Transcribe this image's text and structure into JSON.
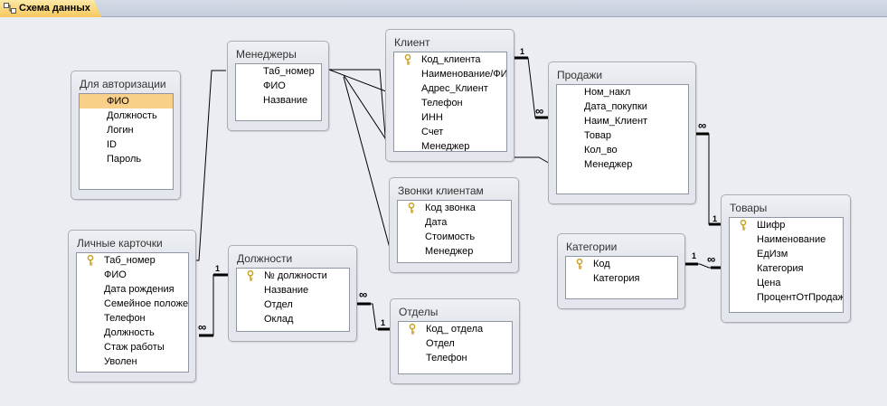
{
  "tab": {
    "label": "Схема данных",
    "icon": "relationships-icon"
  },
  "tables": {
    "auth": {
      "title": "Для авторизации",
      "fields": [
        {
          "name": "ФИО",
          "key": false,
          "selected": true
        },
        {
          "name": "Должность",
          "key": false
        },
        {
          "name": "Логин",
          "key": false
        },
        {
          "name": "ID",
          "key": false
        },
        {
          "name": "Пароль",
          "key": false
        }
      ]
    },
    "cards": {
      "title": "Личные карточки",
      "fields": [
        {
          "name": "Таб_номер",
          "key": true
        },
        {
          "name": "ФИО",
          "key": false
        },
        {
          "name": "Дата рождения",
          "key": false
        },
        {
          "name": "Семейное положение",
          "key": false
        },
        {
          "name": "Телефон",
          "key": false
        },
        {
          "name": "Должность",
          "key": false
        },
        {
          "name": "Стаж работы",
          "key": false
        },
        {
          "name": "Уволен",
          "key": false
        }
      ]
    },
    "managers": {
      "title": "Менеджеры",
      "fields": [
        {
          "name": "Таб_номер",
          "key": false
        },
        {
          "name": "ФИО",
          "key": false
        },
        {
          "name": "Название",
          "key": false
        }
      ]
    },
    "positions": {
      "title": "Должности",
      "fields": [
        {
          "name": "№ должности",
          "key": true
        },
        {
          "name": "Название",
          "key": false
        },
        {
          "name": "Отдел",
          "key": false
        },
        {
          "name": "Оклад",
          "key": false
        }
      ]
    },
    "client": {
      "title": "Клиент",
      "fields": [
        {
          "name": "Код_клиента",
          "key": true
        },
        {
          "name": "Наименование/ФИО",
          "key": false
        },
        {
          "name": "Адрес_Клиент",
          "key": false
        },
        {
          "name": "Телефон",
          "key": false
        },
        {
          "name": "ИНН",
          "key": false
        },
        {
          "name": "Счет",
          "key": false
        },
        {
          "name": "Менеджер",
          "key": false
        }
      ]
    },
    "calls": {
      "title": "Звонки клиентам",
      "fields": [
        {
          "name": "Код звонка",
          "key": true
        },
        {
          "name": "Дата",
          "key": false
        },
        {
          "name": "Стоимость",
          "key": false
        },
        {
          "name": "Менеджер",
          "key": false
        }
      ]
    },
    "depts": {
      "title": "Отделы",
      "fields": [
        {
          "name": "Код_ отдела",
          "key": true
        },
        {
          "name": "Отдел",
          "key": false
        },
        {
          "name": "Телефон",
          "key": false
        }
      ]
    },
    "sales": {
      "title": "Продажи",
      "fields": [
        {
          "name": "Ном_накл",
          "key": false
        },
        {
          "name": "Дата_покупки",
          "key": false
        },
        {
          "name": "Наим_Клиент",
          "key": false
        },
        {
          "name": "Товар",
          "key": false
        },
        {
          "name": "Кол_во",
          "key": false
        },
        {
          "name": "Менеджер",
          "key": false
        }
      ]
    },
    "categories": {
      "title": "Категории",
      "fields": [
        {
          "name": "Код",
          "key": true
        },
        {
          "name": "Категория",
          "key": false
        }
      ]
    },
    "goods": {
      "title": "Товары",
      "fields": [
        {
          "name": "Шифр",
          "key": true
        },
        {
          "name": "Наименование",
          "key": false
        },
        {
          "name": "ЕдИзм",
          "key": false
        },
        {
          "name": "Категория",
          "key": false
        },
        {
          "name": "Цена",
          "key": false
        },
        {
          "name": "ПроцентОтПродаж",
          "key": false
        }
      ]
    }
  },
  "cardinality": {
    "one": "1",
    "many": "∞"
  },
  "colors": {
    "selected_field": "#f9d08a",
    "line": "#000000",
    "key": "#c9a227"
  }
}
